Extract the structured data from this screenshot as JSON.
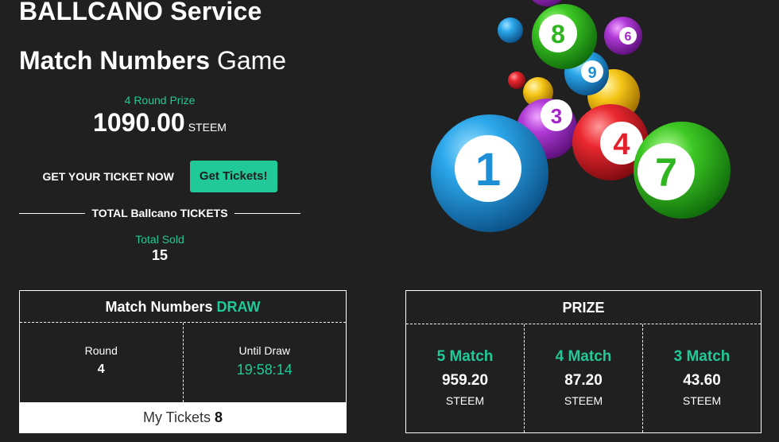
{
  "header": {
    "service_title": "BALLCANO Service",
    "game_title_bold": "Match Numbers",
    "game_title_light": "Game"
  },
  "prize": {
    "label": "4 Round Prize",
    "amount": "1090.00",
    "unit": "STEEM"
  },
  "tickets": {
    "cta_text": "GET YOUR TICKET NOW",
    "button_label": "Get Tickets!"
  },
  "total": {
    "heading": "TOTAL Ballcano TICKETS",
    "sold_label": "Total Sold",
    "sold_value": "15"
  },
  "balls": [
    {
      "number": "1",
      "color": "#1e8fd6"
    },
    {
      "number": "3",
      "color": "#a324c9"
    },
    {
      "number": "4",
      "color": "#e0202a"
    },
    {
      "number": "7",
      "color": "#2fb51f"
    },
    {
      "number": "8",
      "color": "#2fb51f"
    },
    {
      "number": "9",
      "color": "#1e8fd6"
    },
    {
      "number": "6",
      "color": "#a324c9"
    }
  ],
  "draw": {
    "title": "Match Numbers",
    "title_accent": "DRAW",
    "round_label": "Round",
    "round_value": "4",
    "until_label": "Until Draw",
    "until_value": "19:58:14",
    "my_tickets_label": "My Tickets",
    "my_tickets_value": "8"
  },
  "prize_table": {
    "title": "PRIZE",
    "matches": [
      {
        "label": "5 Match",
        "value": "959.20",
        "unit": "STEEM"
      },
      {
        "label": "4 Match",
        "value": "87.20",
        "unit": "STEEM"
      },
      {
        "label": "3 Match",
        "value": "43.60",
        "unit": "STEEM"
      }
    ]
  },
  "colors": {
    "accent": "#20c997",
    "background": "#202020"
  }
}
